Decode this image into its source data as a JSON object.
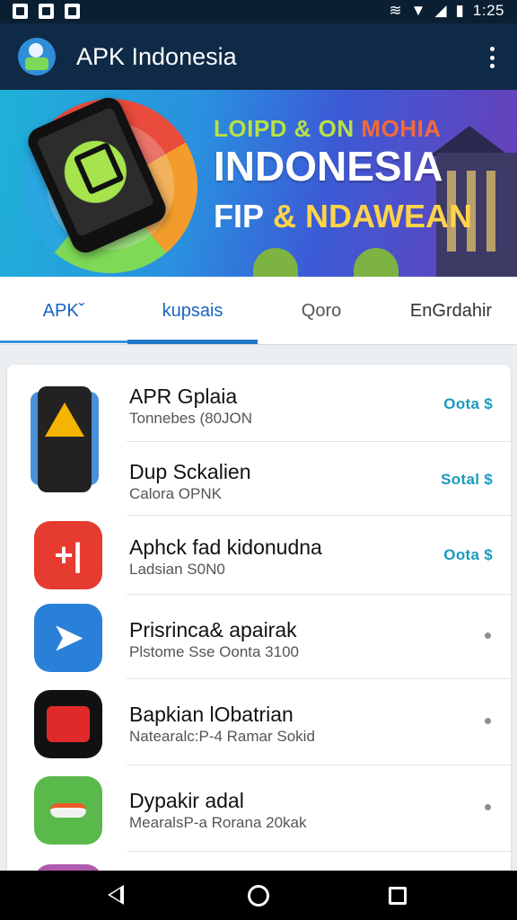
{
  "status_bar": {
    "time": "1:25",
    "left_icons": [
      "gallery-icon",
      "notification-icon",
      "n-app-icon"
    ],
    "right_icons": [
      "vibrate-icon",
      "wifi-icon",
      "signal-icon",
      "battery-icon"
    ]
  },
  "app_bar": {
    "title": "APK Indonesia",
    "logo_icon": "apk-indonesia-logo",
    "menu_icon": "more-vert-icon"
  },
  "banner": {
    "line1": "LOIPD & ON",
    "line1_accent": "MOHIA",
    "line2": "INDONESIA",
    "line3_a": "FIP",
    "line3_b": "&",
    "line3_c": "NDAWEAN"
  },
  "tabs": [
    {
      "label": "APKˇ"
    },
    {
      "label": "kupsais"
    },
    {
      "label": "Qoro"
    },
    {
      "label": "EnGrdahir"
    }
  ],
  "apps": [
    {
      "name": "APR Gplaia",
      "meta": "Tonnebes (80JON",
      "action": "Oota $",
      "icon": "drive-app-icon",
      "icon_color": "#4a90d9"
    },
    {
      "name": "Dup Sckalien",
      "meta": "Calora OPNK",
      "action": "Sotal $",
      "icon": "drive-app-icon",
      "icon_color": "#4a90d9"
    },
    {
      "name": "Aphck fad kidonudna",
      "meta": "Ladsian S0N0",
      "action": "Oota $",
      "icon": "split-app-icon",
      "icon_color": "#e63b30"
    },
    {
      "name": "Prisrinca& apairak",
      "meta": "Plstome Sse Oonta 3100",
      "action": "",
      "icon": "arrow-app-icon",
      "icon_color": "#2a7fd8"
    },
    {
      "name": "Bapkian lObatrian",
      "meta": "Natearalc:P-4 Ramar Sokid",
      "action": "",
      "icon": "camera-app-icon",
      "icon_color": "#111111"
    },
    {
      "name": "Dypakir adal",
      "meta": "MearalsP-a Rorana 20kak",
      "action": "",
      "icon": "pill-app-icon",
      "icon_color": "#59b94a"
    }
  ],
  "nav_bar": {
    "back_icon": "back-icon",
    "home_icon": "home-icon",
    "recents_icon": "recents-icon"
  }
}
